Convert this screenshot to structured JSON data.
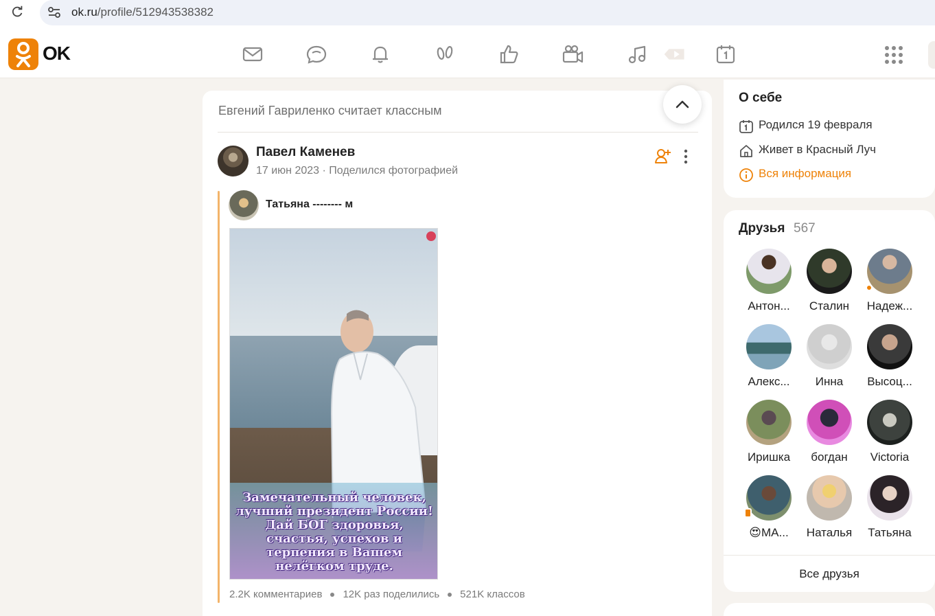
{
  "browser": {
    "url_host": "ok.ru",
    "url_path": "/profile/512943538382"
  },
  "header": {
    "logo_text": "OK",
    "nav_icons": [
      "messages-icon",
      "discussions-icon",
      "notifications-icon",
      "guests-icon",
      "events-icon",
      "video-icon",
      "music-icon",
      "ad-video-icon",
      "calendar-icon"
    ]
  },
  "feed": {
    "liked_by_note": "Евгений Гавриленко считает классным",
    "post": {
      "author": "Павел Каменев",
      "date": "17 июн 2023",
      "action": "Поделился фотографией",
      "repost_author": "Татьяна -------- м",
      "photo_caption": "Замечательный человек, лучший президент России! Дай БОГ здоровья, счастья, успехов и терпения в Вашем нелёгком труде.",
      "comments": "2.2K комментариев",
      "shares": "12K раз поделились",
      "klasses": "521K классов"
    }
  },
  "about": {
    "title": "О себе",
    "birthday": "Родился 19 февраля",
    "lives_in": "Живет в Красный Луч",
    "all_info_link": "Вся информация"
  },
  "friends": {
    "title": "Друзья",
    "count": "567",
    "list": [
      {
        "name": "Антон..."
      },
      {
        "name": "Сталин"
      },
      {
        "name": "Надеж..."
      },
      {
        "name": "Алекс..."
      },
      {
        "name": "Инна"
      },
      {
        "name": "Высоц..."
      },
      {
        "name": "Иришка"
      },
      {
        "name": "богдан"
      },
      {
        "name": "Victoria"
      },
      {
        "name": "😍МА..."
      },
      {
        "name": "Наталья"
      },
      {
        "name": "Татьяна"
      }
    ],
    "all_friends_label": "Все друзья"
  },
  "colors": {
    "brand_orange": "#ee8208",
    "page_bg": "#f6f3ef"
  }
}
